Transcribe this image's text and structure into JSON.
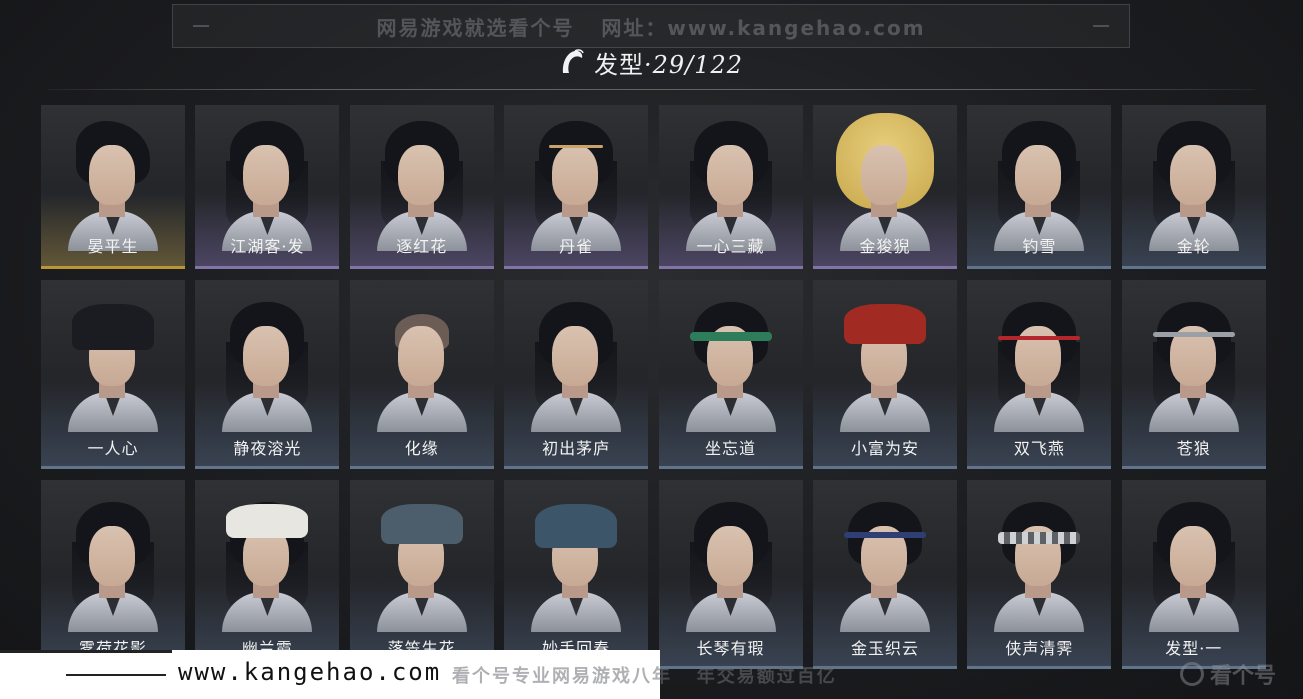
{
  "watermark": {
    "top_text": "网易游戏就选看个号   网址：www.kangehao.com",
    "bottom_slogan": "看个号专业网易游戏八年   年交易额过百亿",
    "site_url": "www.kangehao.com",
    "brand": "看个号"
  },
  "header": {
    "icon": "hair-icon",
    "title": "发型",
    "count": "·29/122"
  },
  "hairstyles": [
    {
      "name": "晏平生",
      "rarity": "gold"
    },
    {
      "name": "江湖客·发",
      "rarity": "purple"
    },
    {
      "name": "逐红花",
      "rarity": "purple"
    },
    {
      "name": "丹雀",
      "rarity": "purple"
    },
    {
      "name": "一心三藏",
      "rarity": "purple"
    },
    {
      "name": "金狻猊",
      "rarity": "purple"
    },
    {
      "name": "钓雪",
      "rarity": "blue"
    },
    {
      "name": "金轮",
      "rarity": "blue"
    },
    {
      "name": "一人心",
      "rarity": "blue"
    },
    {
      "name": "静夜溶光",
      "rarity": "blue"
    },
    {
      "name": "化缘",
      "rarity": "blue"
    },
    {
      "name": "初出茅庐",
      "rarity": "blue"
    },
    {
      "name": "坐忘道",
      "rarity": "blue"
    },
    {
      "name": "小富为安",
      "rarity": "blue"
    },
    {
      "name": "双飞燕",
      "rarity": "blue"
    },
    {
      "name": "苍狼",
      "rarity": "blue"
    },
    {
      "name": "雾荷花影",
      "rarity": "blue"
    },
    {
      "name": "幽兰霞",
      "rarity": "blue"
    },
    {
      "name": "落笠生花",
      "rarity": "blue"
    },
    {
      "name": "妙手回春",
      "rarity": "blue"
    },
    {
      "name": "长琴有瑕",
      "rarity": "blue"
    },
    {
      "name": "金玉织云",
      "rarity": "blue"
    },
    {
      "name": "侠声清霁",
      "rarity": "blue"
    },
    {
      "name": "发型·一",
      "rarity": "blue"
    }
  ],
  "colors": {
    "gold": "#c9a13a",
    "purple": "#8c7cb0",
    "blue": "#6a7c96"
  }
}
